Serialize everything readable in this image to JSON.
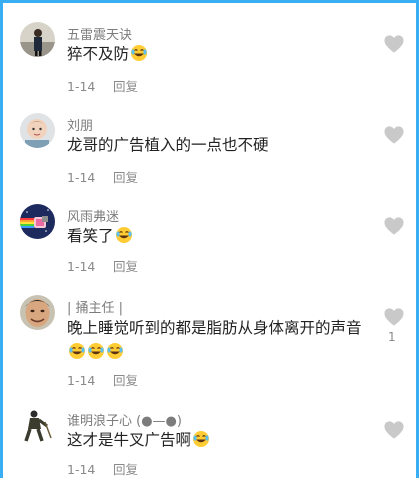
{
  "comments": [
    {
      "user": "五雷震天诀",
      "text": "猝不及防",
      "emoji_count": 1,
      "date": "1-14",
      "reply": "回复",
      "likes": ""
    },
    {
      "user": "刘朋",
      "text": "龙哥的广告植入的一点也不硬",
      "emoji_count": 0,
      "date": "1-14",
      "reply": "回复",
      "likes": ""
    },
    {
      "user": "风雨弗迷",
      "text": "看笑了",
      "emoji_count": 1,
      "date": "1-14",
      "reply": "回复",
      "likes": ""
    },
    {
      "user": "| 捅主任 |",
      "text": "晚上睡觉听到的都是脂肪从身体离开的声音",
      "emoji_count": 3,
      "date": "1-14",
      "reply": "回复",
      "likes": "1"
    },
    {
      "user": "谁明浪子心 (●—●)",
      "text": "这才是牛叉广告啊",
      "emoji_count": 1,
      "date": "1-14",
      "reply": "回复",
      "likes": ""
    }
  ],
  "icons": {
    "like": "heart-icon",
    "emoji": "laughing-crying-emoji"
  },
  "colors": {
    "frame": "#39aef2",
    "username": "#7c7c7c",
    "text": "#222222",
    "meta": "#8a8a8a",
    "heart": "#c9c9c9"
  }
}
